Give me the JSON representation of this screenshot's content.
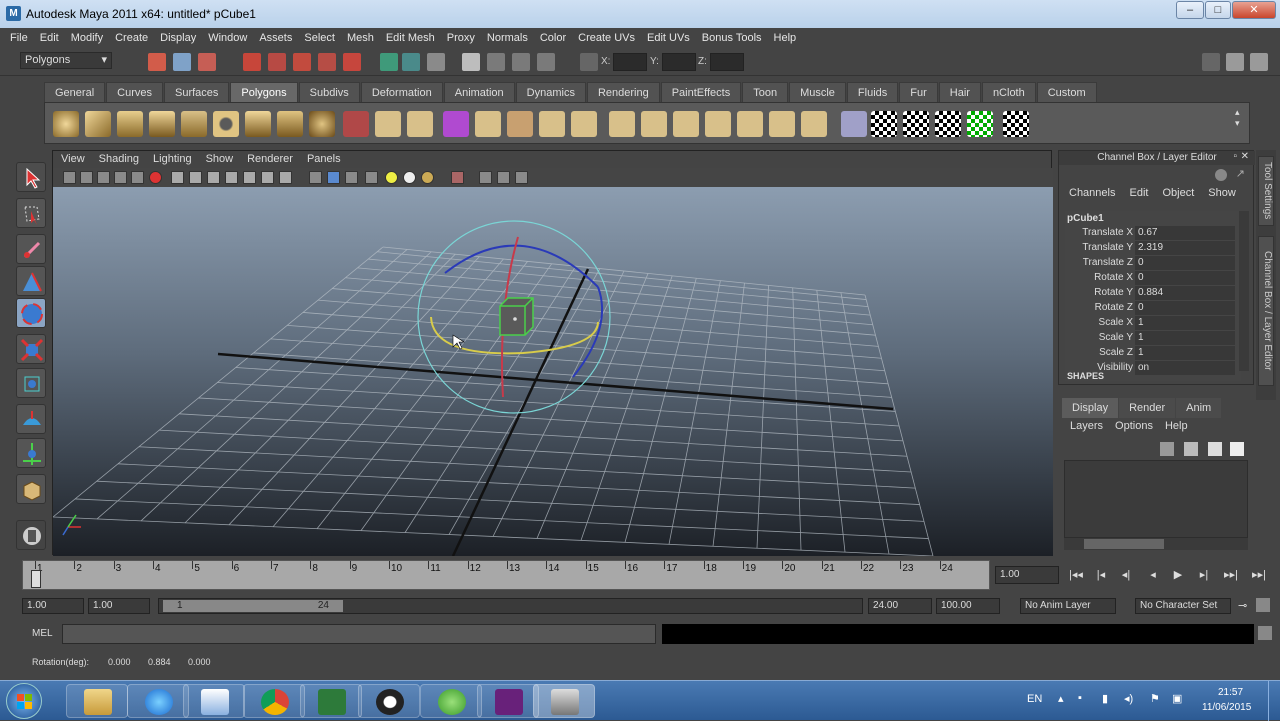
{
  "window": {
    "title": "Autodesk Maya 2011 x64: untitled*    pCube1",
    "min": "–",
    "max": "□",
    "close": "✕"
  },
  "menu": [
    "File",
    "Edit",
    "Modify",
    "Create",
    "Display",
    "Window",
    "Assets",
    "Select",
    "Mesh",
    "Edit Mesh",
    "Proxy",
    "Normals",
    "Color",
    "Create UVs",
    "Edit UVs",
    "Bonus Tools",
    "Help"
  ],
  "statusline": {
    "mode": "Polygons",
    "x_label": "X:",
    "y_label": "Y:",
    "z_label": "Z:"
  },
  "shelf_tabs": [
    "General",
    "Curves",
    "Surfaces",
    "Polygons",
    "Subdivs",
    "Deformation",
    "Animation",
    "Dynamics",
    "Rendering",
    "PaintEffects",
    "Toon",
    "Muscle",
    "Fluids",
    "Fur",
    "Hair",
    "nCloth",
    "Custom"
  ],
  "shelf_active": "Polygons",
  "viewport": {
    "menu": [
      "View",
      "Shading",
      "Lighting",
      "Show",
      "Renderer",
      "Panels"
    ]
  },
  "channel_box": {
    "header": "Channel Box / Layer Editor",
    "menu": [
      "Channels",
      "Edit",
      "Object",
      "Show"
    ],
    "object": "pCube1",
    "channels": [
      {
        "name": "Translate X",
        "value": "0.67"
      },
      {
        "name": "Translate Y",
        "value": "2.319"
      },
      {
        "name": "Translate Z",
        "value": "0"
      },
      {
        "name": "Rotate X",
        "value": "0"
      },
      {
        "name": "Rotate Y",
        "value": "0.884"
      },
      {
        "name": "Rotate Z",
        "value": "0"
      },
      {
        "name": "Scale X",
        "value": "1"
      },
      {
        "name": "Scale Y",
        "value": "1"
      },
      {
        "name": "Scale Z",
        "value": "1"
      },
      {
        "name": "Visibility",
        "value": "on"
      }
    ],
    "shapes_label": "SHAPES"
  },
  "side_tabs": [
    "Tool Settings",
    "Channel Box / Layer Editor"
  ],
  "layer_editor": {
    "tabs": [
      "Display",
      "Render",
      "Anim"
    ],
    "menu": [
      "Layers",
      "Options",
      "Help"
    ]
  },
  "timeline": {
    "ticks": [
      "1",
      "2",
      "3",
      "4",
      "5",
      "6",
      "7",
      "8",
      "9",
      "10",
      "11",
      "12",
      "13",
      "14",
      "15",
      "16",
      "17",
      "18",
      "19",
      "20",
      "21",
      "22",
      "23",
      "24"
    ],
    "current_frame": "1.00"
  },
  "playback": [
    "|◂◂",
    "|◂",
    "◂|",
    "◂",
    "▶",
    "▸|",
    "▸▸|",
    "▸▸|"
  ],
  "range": {
    "start_time": "1.00",
    "start_range": "1.00",
    "slider_start": "1",
    "slider_end": "24",
    "end_range": "24.00",
    "end_time": "100.00",
    "anim_layer": "No Anim Layer",
    "char_set": "No Character Set"
  },
  "cmd": {
    "label": "MEL"
  },
  "helpline": {
    "label": "Rotation(deg):",
    "v1": "0.000",
    "v2": "0.884",
    "v3": "0.000"
  },
  "taskbar": {
    "lang": "EN",
    "time": "21:57",
    "date": "11/06/2015"
  }
}
